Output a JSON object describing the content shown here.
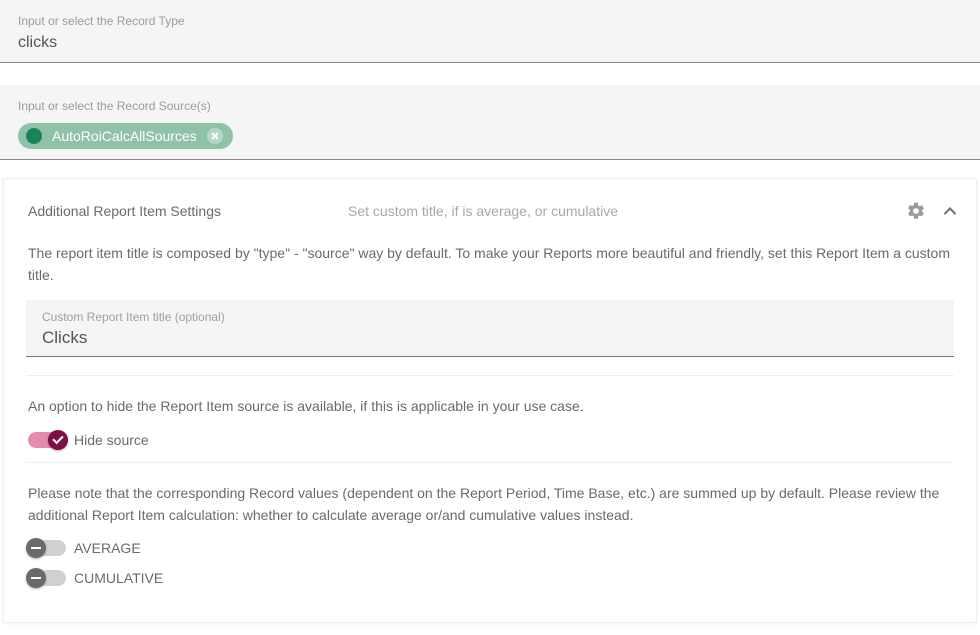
{
  "recordType": {
    "label": "Input or select the Record Type",
    "value": "clicks"
  },
  "recordSource": {
    "label": "Input or select the Record Source(s)",
    "chip": "AutoRoiCalcAllSources"
  },
  "settings": {
    "header": "Additional Report Item Settings",
    "subheader": "Set custom title, if is average, or cumulative",
    "customTitleDesc": "The report item title is composed by \"type\" - \"source\" way by default. To make your Reports more beautiful and friendly, set this Report Item a custom title.",
    "customTitle": {
      "label": "Custom Report Item title (optional)",
      "value": "Clicks"
    },
    "hideSourceDesc": "An option to hide the Report Item source is available, if this is applicable in your use case.",
    "hideSourceLabel": "Hide source",
    "calcDesc": "Please note that the corresponding Record values (dependent on the Report Period, Time Base, etc.) are summed up by default. Please review the additional Report Item calculation: whether to calculate average or/and cumulative values instead.",
    "averageLabel": "AVERAGE",
    "cumulativeLabel": "CUMULATIVE"
  }
}
